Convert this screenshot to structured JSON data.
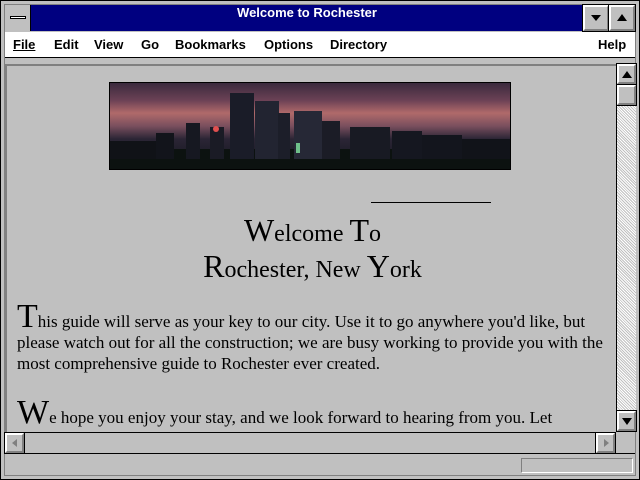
{
  "window": {
    "title": "Welcome to Rochester"
  },
  "menu": [
    {
      "label": "File"
    },
    {
      "label": "Edit"
    },
    {
      "label": "View"
    },
    {
      "label": "Go"
    },
    {
      "label": "Bookmarks"
    },
    {
      "label": "Options"
    },
    {
      "label": "Directory"
    },
    {
      "label": "Help"
    }
  ],
  "page": {
    "banner_alt": "Rochester skyline at dusk",
    "heading_line1_cap": "W",
    "heading_line1_rest": "elcome ",
    "heading_line1_cap2": "T",
    "heading_line1_rest2": "o",
    "heading_line2_cap": "R",
    "heading_line2_rest": "ochester, New ",
    "heading_line2_cap2": "Y",
    "heading_line2_rest2": "ork",
    "para1_drop": "T",
    "para1_text": "his guide will serve as your key to our city. Use it to go anywhere you'd like, but please watch out for all the construction; we are busy working to provide you with the most comprehensive guide to Rochester ever created.",
    "para2_drop": "W",
    "para2_text": "e hope you enjoy your stay, and we look forward to hearing from you. Let"
  },
  "status": {
    "text": ""
  }
}
